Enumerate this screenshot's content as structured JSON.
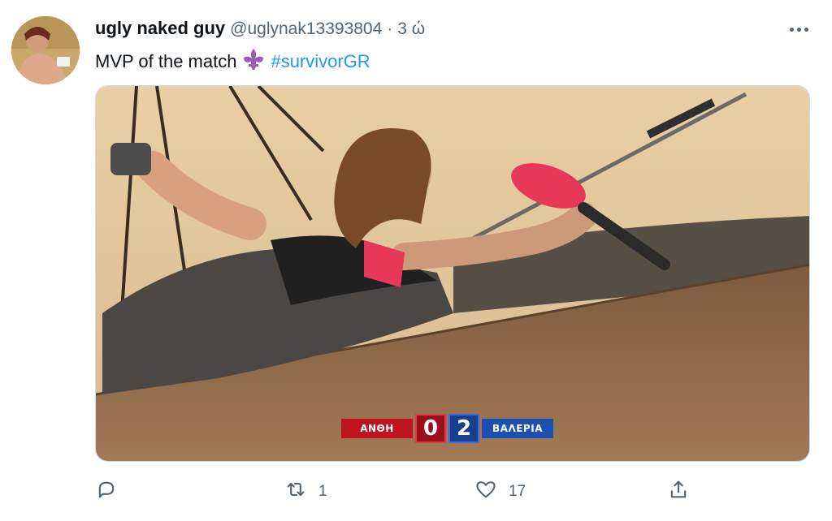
{
  "tweet": {
    "display_name": "ugly naked guy",
    "handle": "@uglynak13393804",
    "separator": "·",
    "time": "3 ώ",
    "text": "MVP of the match",
    "hashtag": "#survivorGR",
    "emoji": "fleur-de-lis-icon"
  },
  "media": {
    "scoreboard": {
      "team_left": "ΑΝΘΗ",
      "score_left": "0",
      "score_right": "2",
      "team_right": "ΒΑΛΕΡΙΑ"
    }
  },
  "actions": {
    "reply_count": "",
    "retweet_count": "1",
    "like_count": "17"
  },
  "colors": {
    "link": "#1d9bf0",
    "secondary_text": "#536471",
    "team_red": "#c1121f",
    "team_blue": "#1d4fb3"
  }
}
